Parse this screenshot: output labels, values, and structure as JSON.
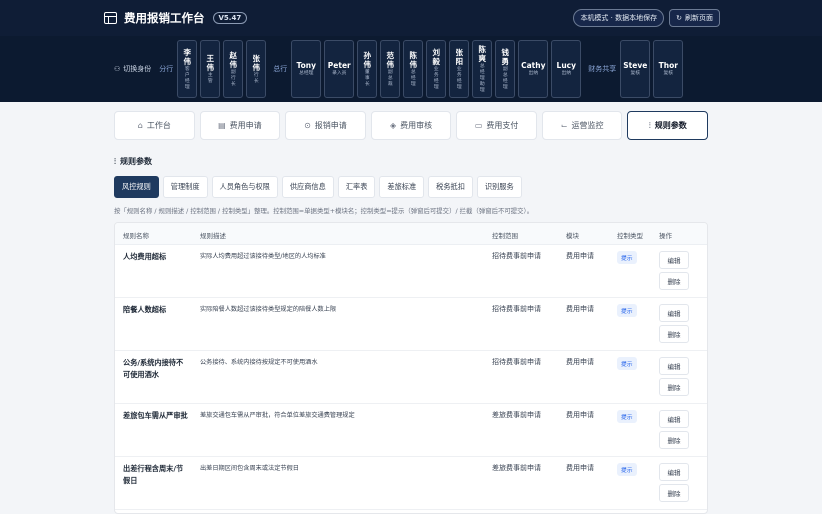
{
  "header": {
    "title": "费用报销工作台",
    "version": "V5.47",
    "mode": "本机模式 · 数据本地保存",
    "refresh": "刷新页面",
    "refresh_icon": "↻"
  },
  "rolebar": {
    "switch_label": "切换身份",
    "groups": [
      {
        "label": "分行",
        "people": [
          {
            "n": "李伟",
            "s": "客户经理",
            "v": true
          },
          {
            "n": "王伟",
            "s": "主管",
            "v": true
          },
          {
            "n": "赵伟",
            "s": "副行长",
            "v": true
          },
          {
            "n": "张伟",
            "s": "行长",
            "v": true
          }
        ]
      },
      {
        "label": "总行",
        "people": [
          {
            "n": "Tony",
            "s": "总经理",
            "v": false
          },
          {
            "n": "Peter",
            "s": "录入员",
            "v": false
          },
          {
            "n": "孙伟",
            "s": "董事长",
            "v": true
          },
          {
            "n": "范伟",
            "s": "副总裁",
            "v": true
          },
          {
            "n": "陈伟",
            "s": "总经理",
            "v": true
          },
          {
            "n": "刘毅",
            "s": "业务经理",
            "v": true
          },
          {
            "n": "张阳",
            "s": "业务经理",
            "v": true
          },
          {
            "n": "陈爽",
            "s": "总经理助理",
            "v": true
          },
          {
            "n": "钱勇",
            "s": "副总经理",
            "v": true
          },
          {
            "n": "Cathy",
            "s": "出纳",
            "v": false
          },
          {
            "n": "Lucy",
            "s": "出纳",
            "v": false
          }
        ]
      },
      {
        "label": "财务共享",
        "people": [
          {
            "n": "Steve",
            "s": "复核",
            "v": false
          },
          {
            "n": "Thor",
            "s": "复核",
            "v": false
          }
        ]
      }
    ]
  },
  "tabs": [
    {
      "label": "工作台",
      "icon": "⌂",
      "name": "home"
    },
    {
      "label": "费用申请",
      "icon": "▤",
      "name": "apply"
    },
    {
      "label": "报销申请",
      "icon": "⊙",
      "name": "reimburse"
    },
    {
      "label": "费用审核",
      "icon": "◈",
      "name": "audit"
    },
    {
      "label": "费用支付",
      "icon": "▭",
      "name": "pay"
    },
    {
      "label": "运营监控",
      "icon": "⌙",
      "name": "monitor"
    },
    {
      "label": "规则参数",
      "icon": "⫶",
      "name": "rules",
      "active": true
    }
  ],
  "section": {
    "title": "规则参数",
    "icon": "⫶"
  },
  "subtabs": [
    {
      "label": "风控规则",
      "active": true
    },
    {
      "label": "管理制度"
    },
    {
      "label": "人员角色与权限"
    },
    {
      "label": "供应商信息"
    },
    {
      "label": "汇率表"
    },
    {
      "label": "差旅标准"
    },
    {
      "label": "税务抵扣"
    },
    {
      "label": "识别服务"
    }
  ],
  "hint": "按「规则名称 / 规则描述 / 控制范围 / 控制类型」整理。控制范围=单据类型+模块名；控制类型=提示（弹窗后可提交）/ 拦截（弹窗后不可提交）。",
  "table": {
    "columns": [
      "规则名称",
      "规则描述",
      "控制范围",
      "模块",
      "控制类型",
      "操作"
    ],
    "edit": "编辑",
    "del": "删除",
    "rows": [
      {
        "name": "人均费用超标",
        "desc": "实际人均费用超过该接待类型/地区的人均标准",
        "scope": "招待费事前申请",
        "module": "费用申请",
        "type": "提示"
      },
      {
        "name": "陪餐人数超标",
        "desc": "实际陪餐人数超过该接待类型规定的陪餐人数上限",
        "scope": "招待费事前申请",
        "module": "费用申请",
        "type": "提示"
      },
      {
        "name": "公务/系统内接待不可使用酒水",
        "desc": "公务接待、系统内接待按规定不可使用酒水",
        "scope": "招待费事前申请",
        "module": "费用申请",
        "type": "提示"
      },
      {
        "name": "差旅包车需从严审批",
        "desc": "差旅交通包车需从严审批，符合单位差旅交通费管理规定",
        "scope": "差旅费事前申请",
        "module": "费用申请",
        "type": "提示"
      },
      {
        "name": "出差行程含周末/节假日",
        "desc": "出差日期区间包含周末或法定节假日",
        "scope": "差旅费事前申请",
        "module": "费用申请",
        "type": "提示"
      }
    ]
  }
}
